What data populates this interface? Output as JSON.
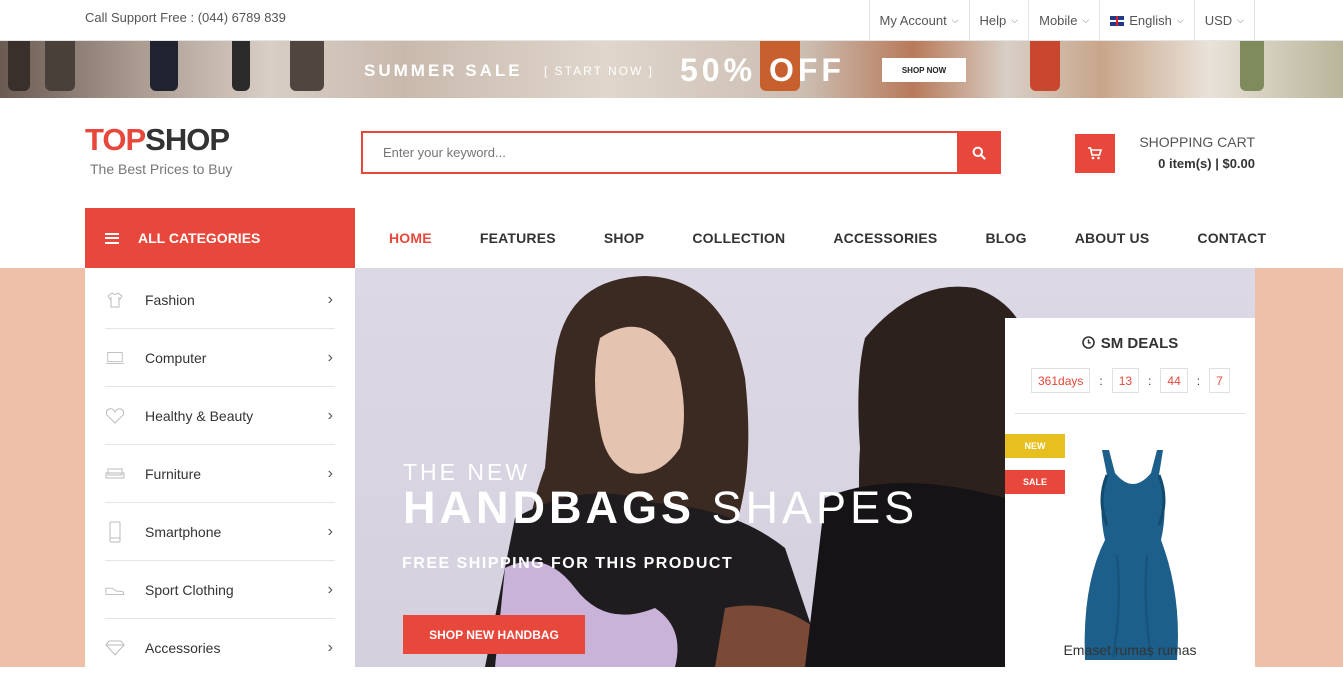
{
  "topbar": {
    "support": "Call Support Free : (044) 6789 839",
    "menus": [
      {
        "label": "My Account"
      },
      {
        "label": "Help"
      },
      {
        "label": "Mobile"
      },
      {
        "label": "English",
        "icon": "uk-flag-icon"
      },
      {
        "label": "USD"
      }
    ]
  },
  "promo": {
    "summer": "SUMMER SALE",
    "start": "[ START NOW ]",
    "discount": "50% OFF",
    "button": "SHOP NOW"
  },
  "header": {
    "logo_a": "TOP",
    "logo_b": "SHOP",
    "tagline": "The Best Prices to Buy",
    "search_placeholder": "Enter your keyword...",
    "cart_title": "SHOPPING CART",
    "cart_info": "0 item(s) | $0.00"
  },
  "nav": {
    "all_categories": "ALL CATEGORIES",
    "items": [
      "HOME",
      "FEATURES",
      "SHOP",
      "COLLECTION",
      "ACCESSORIES",
      "BLOG",
      "ABOUT US",
      "CONTACT"
    ]
  },
  "sidebar": {
    "categories": [
      {
        "label": "Fashion",
        "icon": "shirt-icon"
      },
      {
        "label": "Computer",
        "icon": "laptop-icon"
      },
      {
        "label": "Healthy & Beauty",
        "icon": "heart-icon"
      },
      {
        "label": "Furniture",
        "icon": "sofa-icon"
      },
      {
        "label": "Smartphone",
        "icon": "phone-icon"
      },
      {
        "label": "Sport Clothing",
        "icon": "shoe-icon"
      },
      {
        "label": "Accessories",
        "icon": "diamond-icon"
      }
    ]
  },
  "hero": {
    "line1": "THE NEW",
    "line2_bold": "HANDBAGS",
    "line2_light": "SHAPES",
    "line3": "FREE SHIPPING FOR THIS PRODUCT",
    "button": "SHOP NEW HANDBAG"
  },
  "deals": {
    "title": "SM DEALS",
    "days": "361days",
    "hours": "13",
    "minutes": "44",
    "seconds": "7",
    "tag_new": "NEW",
    "tag_sale": "SALE",
    "product_name": "Emaset rumas rumas"
  },
  "colors": {
    "accent": "#e8483b",
    "hero_bg": "#eec0aa",
    "new_tag": "#e7c020"
  }
}
